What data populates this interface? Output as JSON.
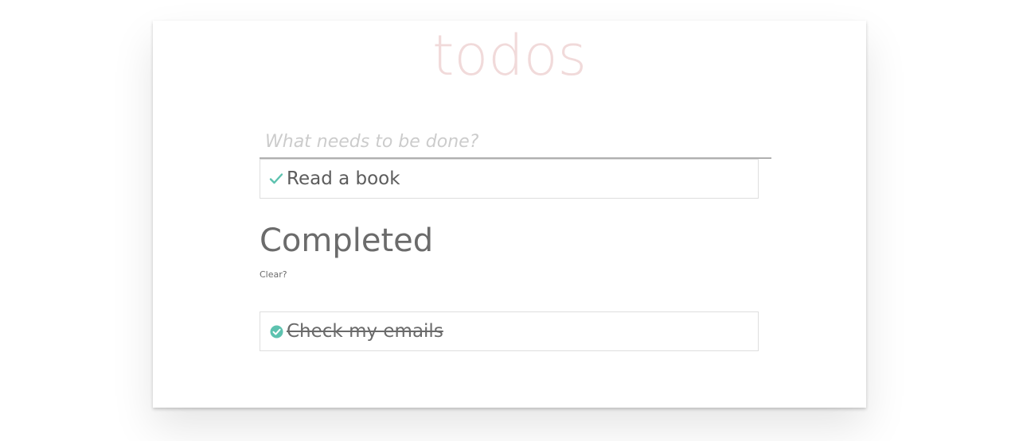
{
  "app": {
    "title": "todos"
  },
  "new_todo": {
    "placeholder": "What needs to be done?",
    "value": ""
  },
  "active_todos": [
    {
      "label": "Read a book",
      "completed": false
    }
  ],
  "completed_section": {
    "heading": "Completed",
    "clear_label": "Clear?"
  },
  "completed_todos": [
    {
      "label": "Check my emails",
      "completed": true
    }
  ],
  "colors": {
    "accent": "#5dc2af",
    "title": "#f1dada",
    "text": "#5c5c5c"
  },
  "icons": {
    "active_check": "checkmark-icon",
    "completed_check": "check-circle-icon"
  }
}
